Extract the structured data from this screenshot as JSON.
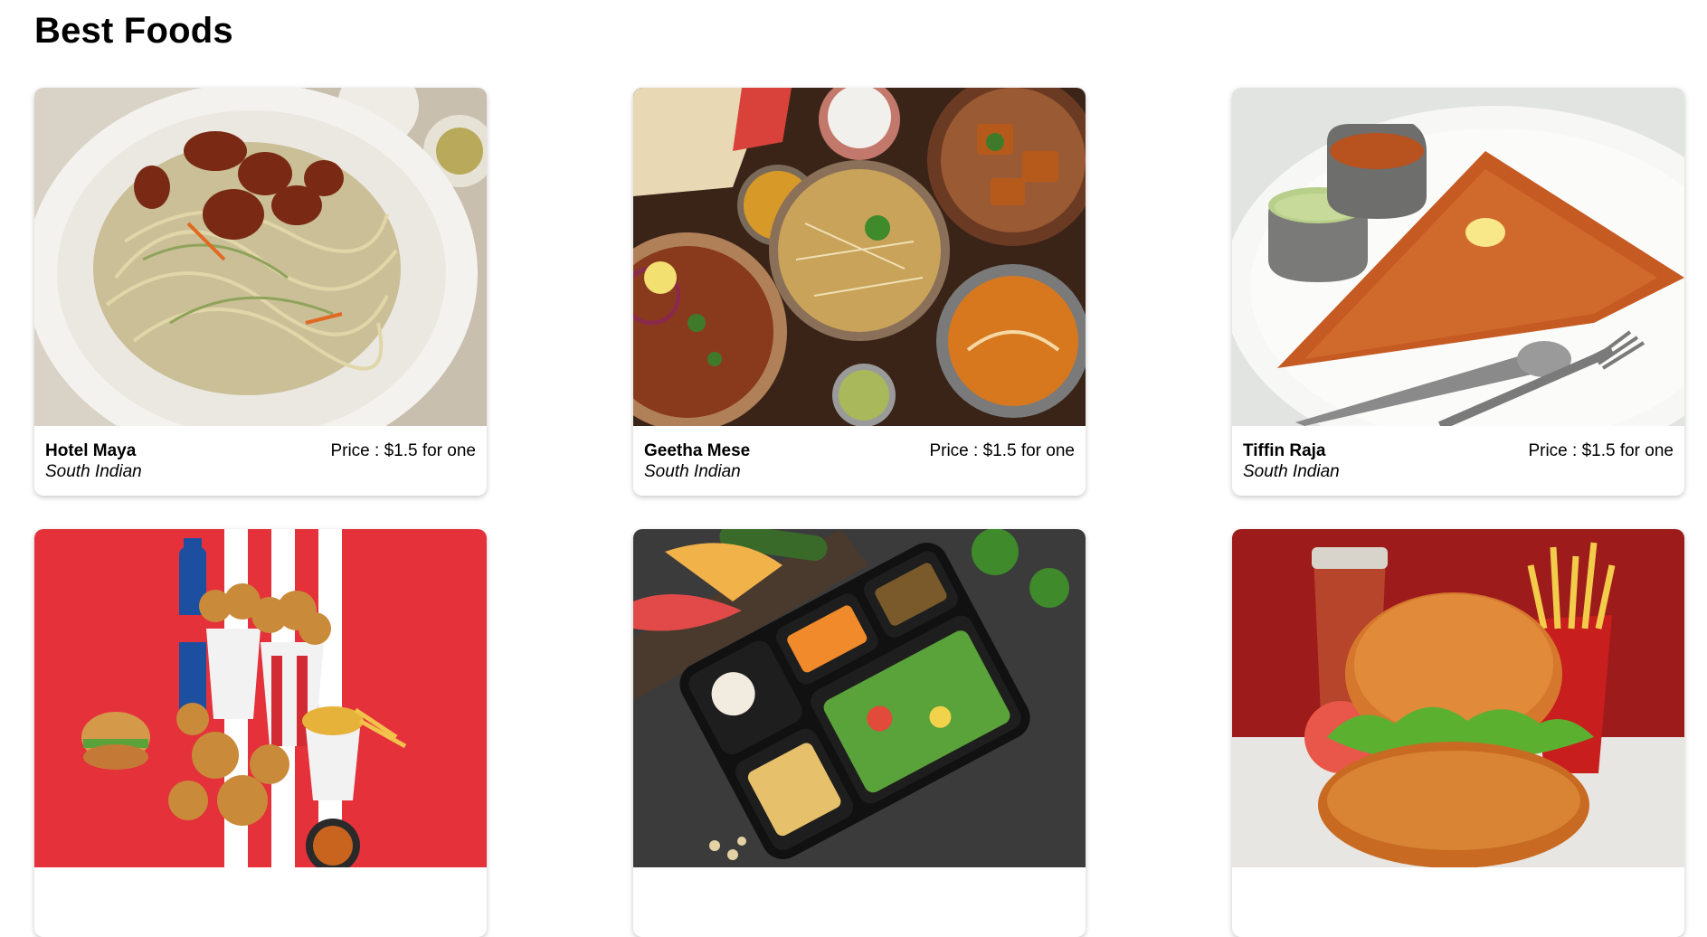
{
  "page": {
    "title": "Best Foods"
  },
  "cards": [
    {
      "name": "Hotel Maya",
      "cuisine": "South Indian",
      "price": "Price : $1.5 for one",
      "image_icon": "noodles-dish-image"
    },
    {
      "name": "Geetha Mese",
      "cuisine": "South Indian",
      "price": "Price : $1.5 for one",
      "image_icon": "biryani-spread-image"
    },
    {
      "name": "Tiffin Raja",
      "cuisine": "South Indian",
      "price": "Price : $1.5 for one",
      "image_icon": "dosa-plate-image"
    },
    {
      "image_icon": "fried-chicken-bucket-image"
    },
    {
      "image_icon": "meal-tray-image"
    },
    {
      "image_icon": "chicken-burger-image"
    }
  ],
  "colors": {
    "kfc_red": "#e4313a",
    "burger_bg": "#9e1b1b",
    "dark_slate": "#3a3a3a",
    "wood": "#3a2418",
    "plate_white": "#f4f2ee"
  }
}
